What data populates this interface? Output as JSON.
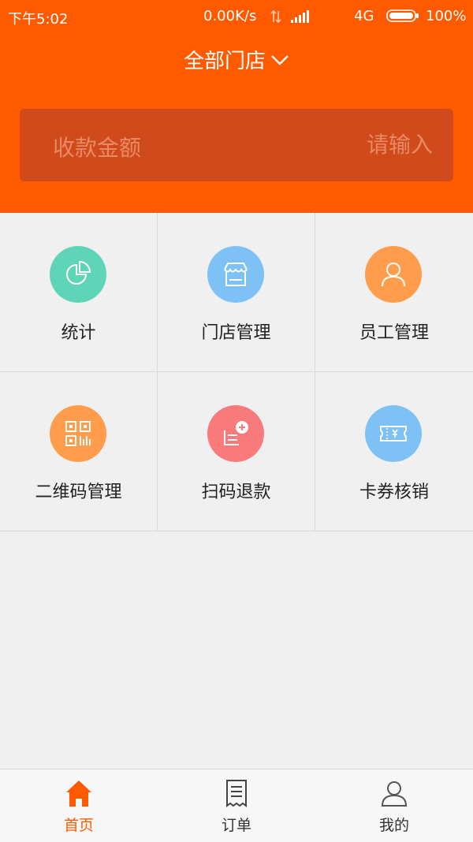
{
  "status_bar": {
    "time": "下午5:02",
    "network_speed": "0.00K/s",
    "network_type": "4G",
    "battery": "100%"
  },
  "header": {
    "store_selector": "全部门店",
    "amount_label": "收款金额",
    "amount_placeholder": "请输入"
  },
  "colors": {
    "brand": "#ff5a00",
    "amount_box": "#d04a1c",
    "teal": "#5fd5b8",
    "blue": "#7ec2f5",
    "orange": "#ff9d4d",
    "red": "#f87a7a"
  },
  "menu": [
    {
      "label": "统计",
      "icon": "pie-chart-icon"
    },
    {
      "label": "门店管理",
      "icon": "store-icon"
    },
    {
      "label": "员工管理",
      "icon": "user-icon"
    },
    {
      "label": "二维码管理",
      "icon": "qrcode-icon"
    },
    {
      "label": "扫码退款",
      "icon": "scan-refund-icon"
    },
    {
      "label": "卡券核销",
      "icon": "coupon-icon"
    }
  ],
  "bottom_nav": [
    {
      "label": "首页",
      "icon": "home-icon",
      "active": true
    },
    {
      "label": "订单",
      "icon": "order-icon",
      "active": false
    },
    {
      "label": "我的",
      "icon": "profile-icon",
      "active": false
    }
  ]
}
